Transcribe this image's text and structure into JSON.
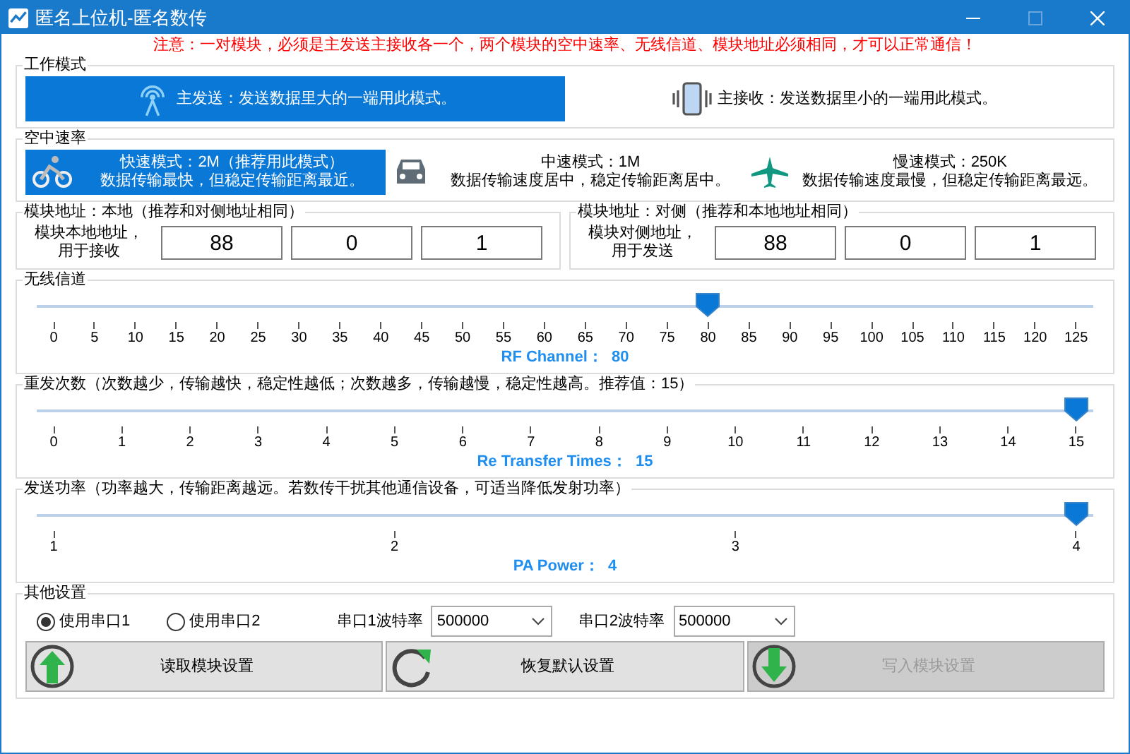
{
  "window": {
    "title": "匿名上位机-匿名数传"
  },
  "notice": "注意：一对模块，必须是主发送主接收各一个，两个模块的空中速率、无线信道、模块地址必须相同，才可以正常通信！",
  "work_mode": {
    "title": "工作模式",
    "options": [
      {
        "kind": "transmit",
        "label": "主发送：发送数据里大的一端用此模式。",
        "selected": true
      },
      {
        "kind": "receive",
        "label": "主接收：发送数据里小的一端用此模式。",
        "selected": false
      }
    ]
  },
  "air_rate": {
    "title": "空中速率",
    "options": [
      {
        "kind": "bike",
        "line1": "快速模式：2M（推荐用此模式）",
        "line2": "数据传输最快，但稳定传输距离最近。",
        "selected": true
      },
      {
        "kind": "car",
        "line1": "中速模式：1M",
        "line2": "数据传输速度居中，稳定传输距离居中。",
        "selected": false
      },
      {
        "kind": "plane",
        "line1": "慢速模式：250K",
        "line2": "数据传输速度最慢，但稳定传输距离最远。",
        "selected": false
      }
    ]
  },
  "addresses": [
    {
      "title": "模块地址：本地（推荐和对侧地址相同）",
      "label_lines": [
        "模块本地地址，",
        "用于接收"
      ],
      "values": [
        "88",
        "0",
        "1"
      ]
    },
    {
      "title": "模块地址：对侧（推荐和本地地址相同）",
      "label_lines": [
        "模块对侧地址，",
        "用于发送"
      ],
      "values": [
        "88",
        "0",
        "1"
      ]
    }
  ],
  "sliders": [
    {
      "title": "无线信道",
      "level": 0.64,
      "ticks": [
        "0",
        "5",
        "10",
        "15",
        "20",
        "25",
        "30",
        "35",
        "40",
        "45",
        "50",
        "55",
        "60",
        "65",
        "70",
        "75",
        "80",
        "85",
        "90",
        "95",
        "100",
        "105",
        "110",
        "115",
        "120",
        "125"
      ],
      "reading": "RF Channel：  80"
    },
    {
      "title": "重发次数（次数越少，传输越快，稳定性越低；次数越多，传输越慢，稳定性越高。推荐值：15）",
      "level": 1,
      "ticks": [
        "0",
        "1",
        "2",
        "3",
        "4",
        "5",
        "6",
        "7",
        "8",
        "9",
        "10",
        "11",
        "12",
        "13",
        "14",
        "15"
      ],
      "reading": "Re Transfer Times：  15"
    },
    {
      "title": "发送功率（功率越大，传输距离越远。若数传干扰其他通信设备，可适当降低发射功率）",
      "level": 1,
      "ticks": [
        "1",
        "2",
        "3",
        "4"
      ],
      "reading": "PA Power：  4"
    }
  ],
  "other": {
    "title": "其他设置",
    "ports": [
      {
        "label": "使用串口1",
        "selected": true
      },
      {
        "label": "使用串口2",
        "selected": false
      }
    ],
    "baud": [
      {
        "label": "串口1波特率",
        "value": "500000"
      },
      {
        "label": "串口2波特率",
        "value": "500000"
      }
    ],
    "buttons": [
      {
        "kind": "read",
        "label": "读取模块设置",
        "disabled": false
      },
      {
        "kind": "reset",
        "label": "恢复默认设置",
        "disabled": false
      },
      {
        "kind": "write",
        "label": "写入模块设置",
        "disabled": true
      }
    ]
  }
}
